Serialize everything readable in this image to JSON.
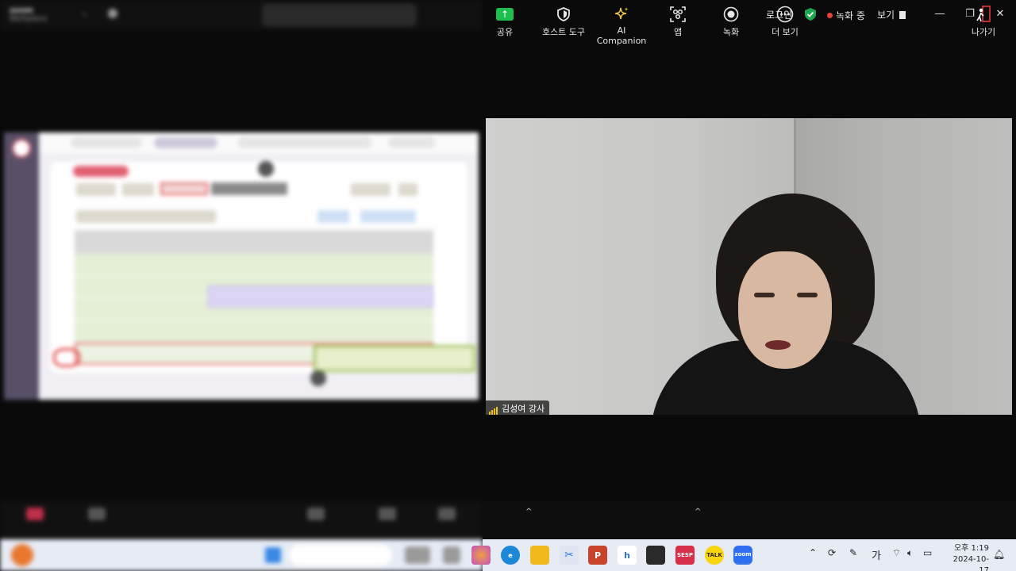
{
  "title_bar": {
    "brand_line1": "zoom",
    "brand_line2": "Workplace",
    "search_placeholder": "",
    "login": "로그인",
    "recording": "녹화 중",
    "view": "보기"
  },
  "video": {
    "participant_name": "김성여 강사"
  },
  "toolbar": {
    "share": "공유",
    "host_tools": "호스트 도구",
    "ai_companion": "AI Companion",
    "apps": "앱",
    "record": "녹화",
    "more": "더 보기",
    "leave": "나가기"
  },
  "taskbar": {
    "ime": "가",
    "time": "오후 1:19",
    "date": "2024-10-17"
  },
  "colors": {
    "share_green": "#1dbf4f",
    "record_red": "#e8413c",
    "shield_green": "#1ea650",
    "leave_red": "#e33b3b",
    "signal_yellow": "#f0c020"
  },
  "icons": {
    "shield": "shield-check-icon",
    "share": "share-screen-icon",
    "host_tools": "shield-icon",
    "ai": "sparkle-icon",
    "apps": "apps-icon",
    "record": "record-icon",
    "more": "more-icon",
    "leave": "leave-icon"
  }
}
